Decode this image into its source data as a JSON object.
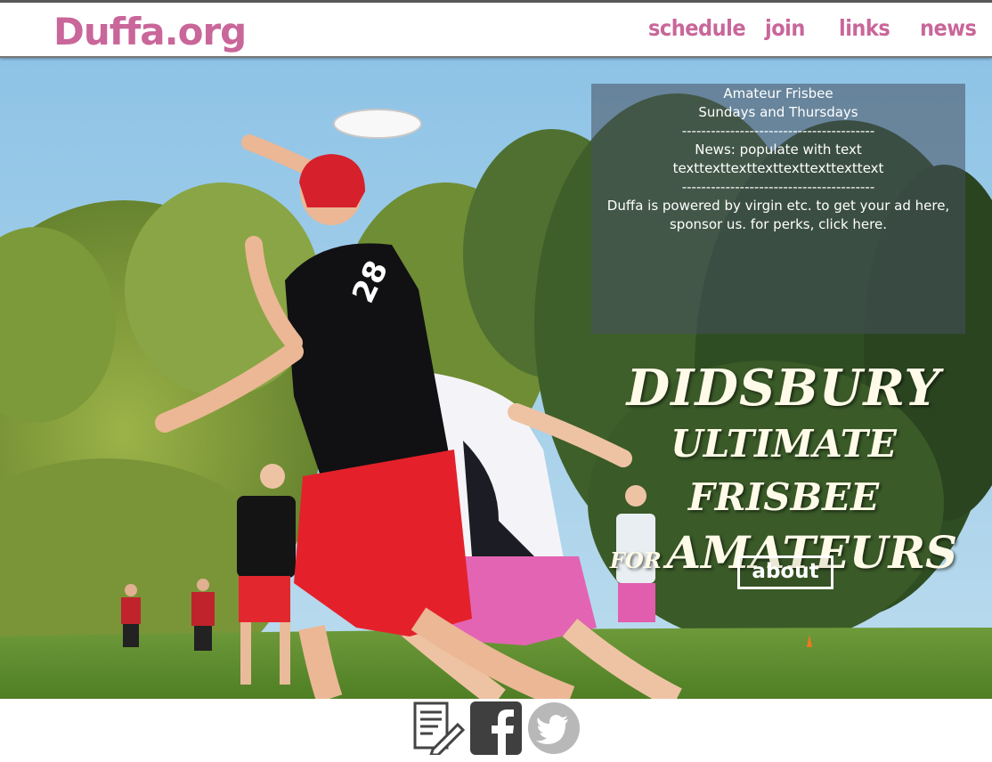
{
  "header": {
    "logo": "Duffa.org",
    "nav": [
      {
        "label": "schedule"
      },
      {
        "label": "join"
      },
      {
        "label": "links"
      },
      {
        "label": "news"
      }
    ]
  },
  "info_box": {
    "lines": [
      "Amateur Frisbee",
      "Sundays and Thursdays",
      "----------------------------------------",
      "News: populate with text",
      "texttexttexttexttexttexttexttext",
      "----------------------------------------",
      "Duffa is powered by virgin etc. to get your ad here,",
      "sponsor us. for perks, click here."
    ]
  },
  "headline": {
    "line1": "DIDSBURY",
    "line2": "ULTIMATE FRISBEE",
    "line3_small": "FOR",
    "line3_big": "AMATEURS"
  },
  "hero": {
    "jersey_number": "28"
  },
  "about_button": "about",
  "footer_icons": [
    "document-edit-icon",
    "facebook-icon",
    "twitter-icon"
  ],
  "colors": {
    "brand": "#c9669a",
    "headline": "#fffbe8"
  }
}
